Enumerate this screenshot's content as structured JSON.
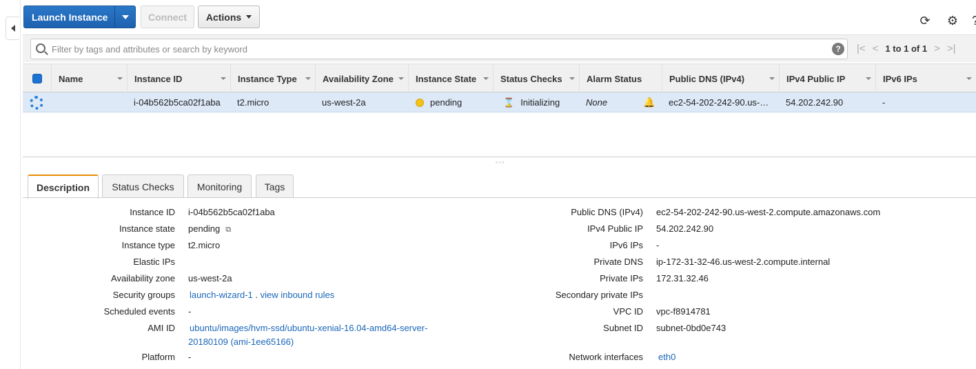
{
  "toolbar": {
    "launch_label": "Launch Instance",
    "connect_label": "Connect",
    "actions_label": "Actions"
  },
  "filter": {
    "placeholder": "Filter by tags and attributes or search by keyword",
    "help": "?",
    "page_text": "1 to 1 of 1"
  },
  "table": {
    "columns": [
      "Name",
      "Instance ID",
      "Instance Type",
      "Availability Zone",
      "Instance State",
      "Status Checks",
      "Alarm Status",
      "Public DNS (IPv4)",
      "IPv4 Public IP",
      "IPv6 IPs"
    ],
    "row": {
      "name": "",
      "instance_id": "i-04b562b5ca02f1aba",
      "instance_type": "t2.micro",
      "az": "us-west-2a",
      "state": "pending",
      "status_checks": "Initializing",
      "alarm": "None",
      "public_dns": "ec2-54-202-242-90.us-…",
      "ipv4": "54.202.242.90",
      "ipv6": "-"
    }
  },
  "tabs": [
    "Description",
    "Status Checks",
    "Monitoring",
    "Tags"
  ],
  "description": {
    "left": [
      {
        "label": "Instance ID",
        "value": "i-04b562b5ca02f1aba"
      },
      {
        "label": "Instance state",
        "value": "pending"
      },
      {
        "label": "Instance type",
        "value": "t2.micro"
      },
      {
        "label": "Elastic IPs",
        "value": ""
      },
      {
        "label": "Availability zone",
        "value": "us-west-2a"
      },
      {
        "label": "Security groups",
        "value": "launch-wizard-1",
        "extra": "view inbound rules"
      },
      {
        "label": "Scheduled events",
        "value": "-"
      },
      {
        "label": "AMI ID",
        "value": "ubuntu/images/hvm-ssd/ubuntu-xenial-16.04-amd64-server-",
        "value2": "20180109 (ami-1ee65166)"
      },
      {
        "label": "Platform",
        "value": "-"
      }
    ],
    "right": [
      {
        "label": "Public DNS (IPv4)",
        "value": "ec2-54-202-242-90.us-west-2.compute.amazonaws.com"
      },
      {
        "label": "IPv4 Public IP",
        "value": "54.202.242.90"
      },
      {
        "label": "IPv6 IPs",
        "value": "-"
      },
      {
        "label": "Private DNS",
        "value": "ip-172-31-32-46.us-west-2.compute.internal"
      },
      {
        "label": "Private IPs",
        "value": "172.31.32.46"
      },
      {
        "label": "Secondary private IPs",
        "value": ""
      },
      {
        "label": "VPC ID",
        "value": "vpc-f8914781"
      },
      {
        "label": "Subnet ID",
        "value": "subnet-0bd0e743"
      },
      {
        "label": "Network interfaces",
        "value": "eth0"
      }
    ]
  }
}
